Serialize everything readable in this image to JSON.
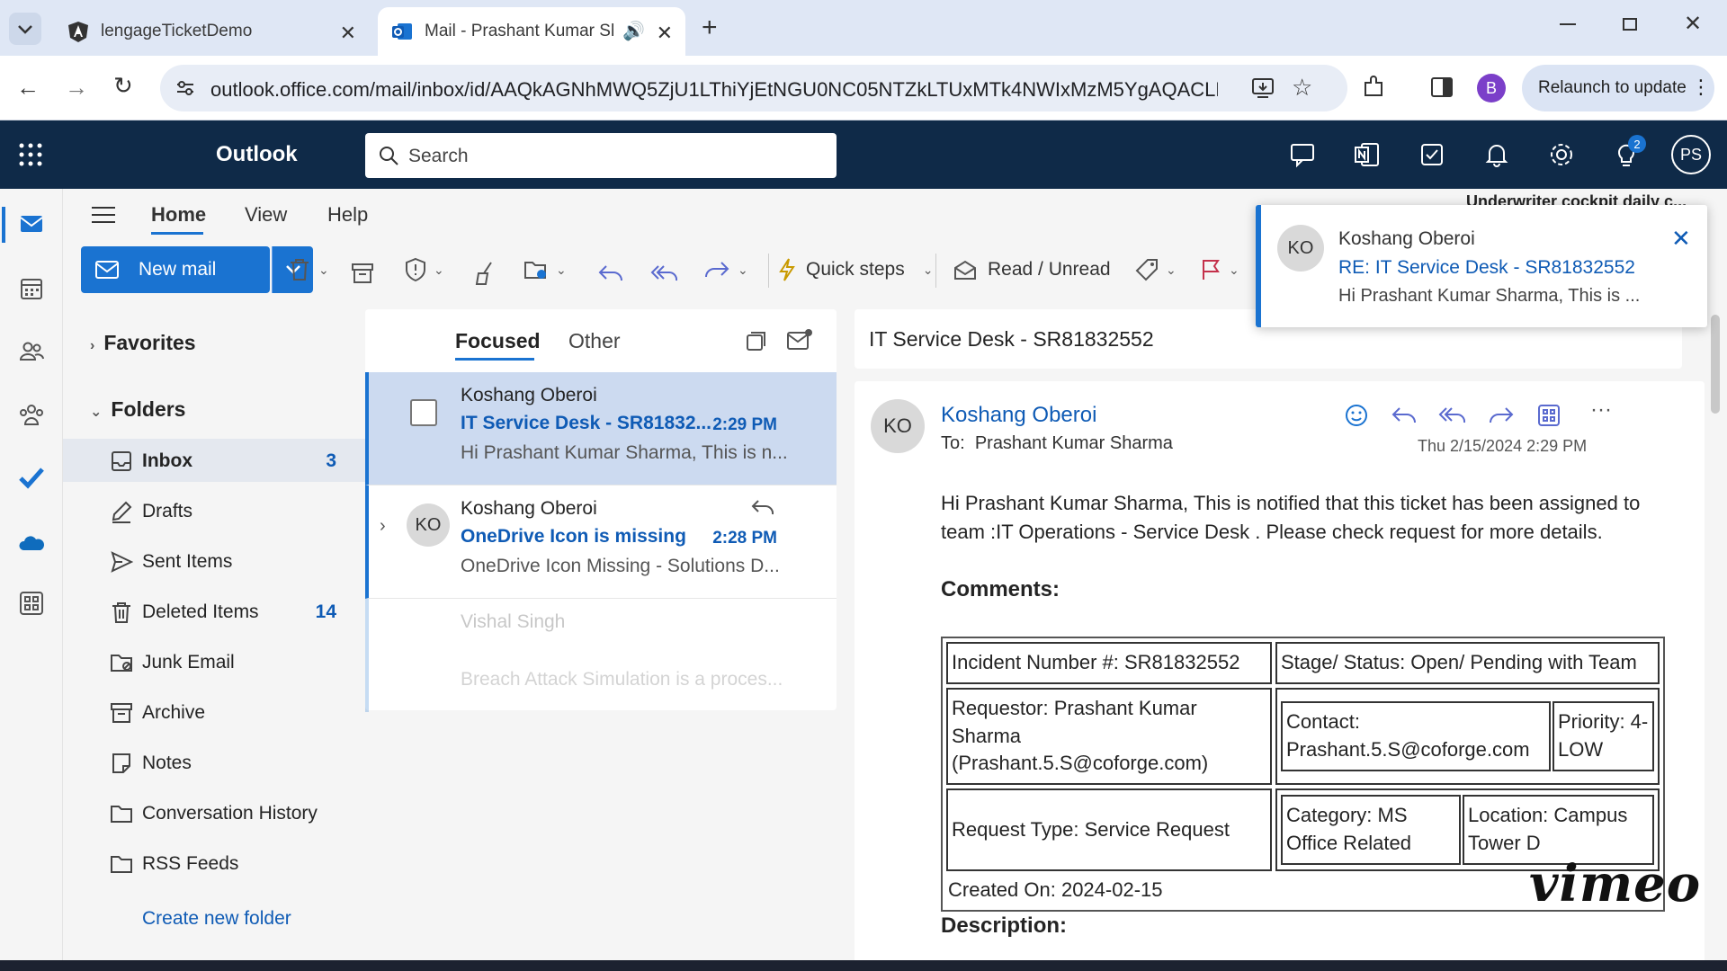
{
  "browser": {
    "tabs": [
      {
        "title": "lengageTicketDemo",
        "active": false
      },
      {
        "title": "Mail - Prashant Kumar Shar",
        "active": true
      }
    ],
    "url": "outlook.office.com/mail/inbox/id/AAQkAGNhMWQ5ZjU1LThiYjEtNGU0NC05NTZkLTUxMTk4NWIxMzM5YgAQACLKIhWC7...",
    "profile_initial": "B",
    "relaunch_label": "Relaunch to update"
  },
  "outlook": {
    "brand": "Outlook",
    "search_placeholder": "Search",
    "notification_badge": "2",
    "user_initials": "PS",
    "accent": "#1a73d1",
    "header_bg": "#0f2a48"
  },
  "ribbon": {
    "tabs": [
      "Home",
      "View",
      "Help"
    ],
    "new_mail": "New mail",
    "quick_steps": "Quick steps",
    "read_unread": "Read / Unread",
    "overflow_text": "Underwriter cockpit daily c..."
  },
  "folders": {
    "favorites_label": "Favorites",
    "folders_label": "Folders",
    "items": [
      {
        "name": "Inbox",
        "count": "3",
        "icon": "inbox-icon"
      },
      {
        "name": "Drafts",
        "count": "",
        "icon": "drafts-icon"
      },
      {
        "name": "Sent Items",
        "count": "",
        "icon": "sent-icon"
      },
      {
        "name": "Deleted Items",
        "count": "14",
        "icon": "trash-icon"
      },
      {
        "name": "Junk Email",
        "count": "",
        "icon": "junk-icon"
      },
      {
        "name": "Archive",
        "count": "",
        "icon": "archive-icon"
      },
      {
        "name": "Notes",
        "count": "",
        "icon": "notes-icon"
      },
      {
        "name": "Conversation History",
        "count": "",
        "icon": "folder-icon"
      },
      {
        "name": "RSS Feeds",
        "count": "",
        "icon": "folder-icon"
      }
    ],
    "create_new": "Create new folder"
  },
  "message_list": {
    "tabs": [
      "Focused",
      "Other"
    ],
    "messages": [
      {
        "sender": "Koshang Oberoi",
        "subject": "IT Service Desk - SR81832...",
        "time": "2:29 PM",
        "preview": "Hi Prashant Kumar Sharma, This is n..."
      },
      {
        "sender": "Koshang Oberoi",
        "initials": "KO",
        "subject": "OneDrive Icon is missing",
        "time": "2:28 PM",
        "preview": "OneDrive Icon Missing - Solutions D..."
      },
      {
        "sender": "Vishal Singh",
        "subject": "",
        "time": "",
        "preview": "Breach Attack Simulation is a proces..."
      }
    ]
  },
  "reading": {
    "subject": "IT Service Desk - SR81832552",
    "from": "Koshang Oberoi",
    "from_initials": "KO",
    "to_label": "To:",
    "to": "Prashant Kumar Sharma",
    "date": "Thu 2/15/2024 2:29 PM",
    "body": "Hi Prashant Kumar Sharma, This is notified that this ticket has been assigned to team :IT Operations - Service Desk . Please check request for more details.",
    "comments_heading": "Comments:",
    "table": {
      "incident": "Incident Number #: SR81832552",
      "stage": "Stage/ Status: Open/ Pending with Team",
      "requestor": "Requestor: Prashant Kumar Sharma (Prashant.5.S@coforge.com)",
      "contact": "Contact: Prashant.5.S@coforge.com",
      "priority": "Priority: 4-LOW",
      "request_type": "Request Type: Service Request",
      "category": "Category: MS Office Related",
      "location": "Location: Campus Tower D",
      "created": "Created On: 2024-02-15"
    },
    "description_heading": "Description:"
  },
  "toast": {
    "initials": "KO",
    "sender": "Koshang Oberoi",
    "subject": "RE: IT Service Desk - SR81832552",
    "preview": "Hi Prashant Kumar Sharma, This is ..."
  },
  "watermark": "vimeo"
}
